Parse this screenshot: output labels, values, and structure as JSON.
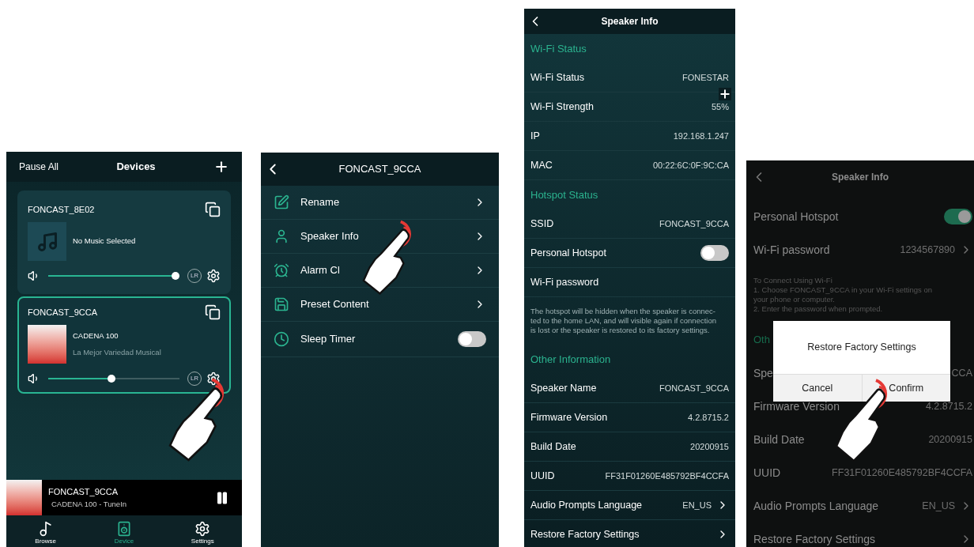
{
  "devices_screen": {
    "header": {
      "left": "Pause All",
      "title": "Devices"
    },
    "devices": [
      {
        "name": "FONCAST_8E02",
        "selected": false,
        "kind": "idle",
        "title": "No Music Selected",
        "level": 0.97,
        "channel": "LR"
      },
      {
        "name": "FONCAST_9CCA",
        "selected": true,
        "kind": "playing",
        "title": "CADENA 100",
        "subtitle": "La Mejor Variedad Musical",
        "level": 0.48,
        "channel": "LR"
      }
    ],
    "now_playing": {
      "title": "FONCAST_9CCA",
      "subtitle": "CADENA 100 - TuneIn"
    },
    "tabs": [
      {
        "label": "Browse",
        "selected": false
      },
      {
        "label": "Device",
        "selected": true
      },
      {
        "label": "Settings",
        "selected": false
      }
    ]
  },
  "device_menu_screen": {
    "title": "FONCAST_9CCA",
    "items": [
      {
        "kind": "link",
        "label": "Rename"
      },
      {
        "kind": "link",
        "label": "Speaker Info"
      },
      {
        "kind": "link",
        "label": "Alarm Cl"
      },
      {
        "kind": "link",
        "label": "Preset Content"
      },
      {
        "kind": "toggle",
        "label": "Sleep Timer",
        "on": false
      }
    ]
  },
  "speaker_info_screen": {
    "title": "Speaker Info",
    "rows": [
      {
        "kind": "section",
        "label": "Wi-Fi Status"
      },
      {
        "kind": "row",
        "label": "Wi-Fi Status",
        "value": "FONESTAR"
      },
      {
        "kind": "row",
        "label": "Wi-Fi Strength",
        "value": "55%"
      },
      {
        "kind": "row",
        "label": "IP",
        "value": "192.168.1.247"
      },
      {
        "kind": "row",
        "label": "MAC",
        "value": "00:22:6C:0F:9C:CA"
      },
      {
        "kind": "section",
        "label": "Hotspot Status"
      },
      {
        "kind": "row",
        "label": "SSID",
        "value": "FONCAST_9CCA"
      },
      {
        "kind": "toggle",
        "label": "Personal Hotspot",
        "on": false
      },
      {
        "kind": "row",
        "label": "Wi-Fi password"
      },
      {
        "kind": "note",
        "label": "The hotspot will be hidden when the speaker is connec-\nted to the home LAN, and will visible again if connection\nis lost or the speaker is restored to its factory settings."
      },
      {
        "kind": "section",
        "label": "Other Information"
      },
      {
        "kind": "row",
        "label": "Speaker Name",
        "value": "FONCAST_9CCA"
      },
      {
        "kind": "row",
        "label": "Firmware Version",
        "value": "4.2.8715.2"
      },
      {
        "kind": "row",
        "label": "Build Date",
        "value": "20200915"
      },
      {
        "kind": "row",
        "label": "UUID",
        "value": "FF31F01260E485792BF4CCFA"
      },
      {
        "kind": "link",
        "label": "Audio Prompts Language",
        "value": "EN_US"
      },
      {
        "kind": "link",
        "label": "Restore Factory Settings"
      }
    ]
  },
  "restore_screen": {
    "title": "Speaker Info",
    "rows": [
      {
        "kind": "toggle",
        "label": "Personal Hotspot",
        "on": true
      },
      {
        "kind": "link",
        "label": "Wi-Fi password",
        "value": "1234567890"
      },
      {
        "kind": "note",
        "label": "To Connect Using Wi-Fi\n1. Choose FONCAST_9CCA in your Wi-Fi settings on\nyour phone or computer.\n2. Enter the password when prompted."
      },
      {
        "kind": "section",
        "label": "Oth"
      },
      {
        "kind": "row",
        "label": "Spe",
        "value": "CCA"
      },
      {
        "kind": "row",
        "label": "Firmware Version",
        "value": "4.2.8715.2"
      },
      {
        "kind": "row",
        "label": "Build Date",
        "value": "20200915"
      },
      {
        "kind": "row",
        "label": "UUID",
        "value": "FF31F01260E485792BF4CCFA"
      },
      {
        "kind": "link",
        "label": "Audio Prompts Language",
        "value": "EN_US"
      },
      {
        "kind": "link",
        "label": "Restore Factory Settings"
      }
    ],
    "dialog": {
      "title": "Restore Factory Settings",
      "buttons": [
        "Cancel",
        "Confirm"
      ]
    }
  }
}
